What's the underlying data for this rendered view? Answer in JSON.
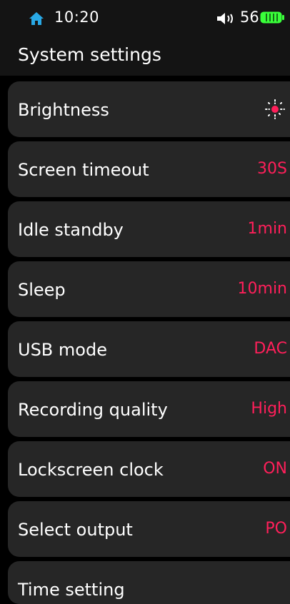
{
  "status": {
    "time": "10:20",
    "volume": "56",
    "icons": [
      "home-icon",
      "speaker-icon",
      "battery-icon"
    ],
    "battery_color": "#39ff3a"
  },
  "header": {
    "title": "System settings"
  },
  "colors": {
    "accent": "#ff1f5a",
    "row_bg": "#262626"
  },
  "settings": [
    {
      "label": "Brightness",
      "value": "",
      "icon": "sun-icon"
    },
    {
      "label": "Screen timeout",
      "value": "30S"
    },
    {
      "label": "Idle standby",
      "value": "1min"
    },
    {
      "label": "Sleep",
      "value": "10min"
    },
    {
      "label": "USB mode",
      "value": "DAC"
    },
    {
      "label": "Recording quality",
      "value": "High"
    },
    {
      "label": "Lockscreen clock",
      "value": "ON"
    },
    {
      "label": "Select output",
      "value": "PO"
    },
    {
      "label": "Time setting",
      "value": ""
    }
  ]
}
